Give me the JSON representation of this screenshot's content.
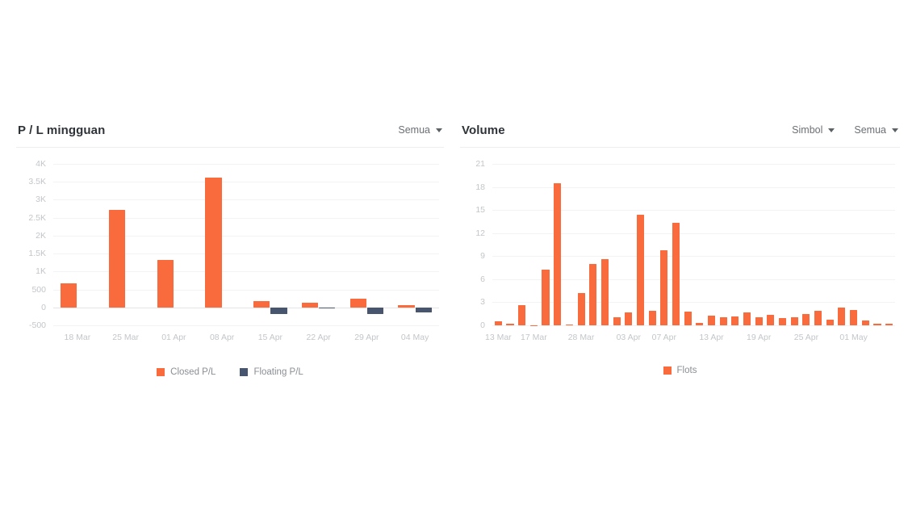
{
  "panels": {
    "left": {
      "title": "P / L mingguan",
      "controls": [
        {
          "label": "Semua",
          "icon": "chevron-down-icon"
        }
      ],
      "legend": [
        {
          "label": "Closed P/L",
          "color": "#f96b3c"
        },
        {
          "label": "Floating P/L",
          "color": "#47566e"
        }
      ]
    },
    "right": {
      "title": "Volume",
      "controls": [
        {
          "label": "Simbol",
          "icon": "chevron-down-icon"
        },
        {
          "label": "Semua",
          "icon": "chevron-down-icon"
        }
      ],
      "legend": [
        {
          "label": "Flots",
          "color": "#f96b3c"
        }
      ]
    }
  },
  "colors": {
    "orange": "#f96b3c",
    "slate": "#47566e",
    "grid": "#f2f3f4",
    "zero_line": "#e2e4e6",
    "axis_text": "#c3c6c9",
    "title_text": "#2e3338",
    "control_text": "#6b7075"
  },
  "chart_data": [
    {
      "id": "weekly-pl",
      "type": "bar",
      "title": "P / L mingguan",
      "xlabel": "",
      "ylabel": "",
      "ylim": [
        -500,
        4000
      ],
      "yticks": [
        4000,
        3500,
        3000,
        2500,
        2000,
        1500,
        1000,
        500,
        0,
        -500
      ],
      "ytick_labels": [
        "4K",
        "3.5K",
        "3K",
        "2.5K",
        "2K",
        "1.5K",
        "1K",
        "500",
        "0",
        "-500"
      ],
      "grid": true,
      "legend_position": "bottom",
      "categories": [
        "18 Mar",
        "25 Mar",
        "01 Apr",
        "08 Apr",
        "15 Apr",
        "22 Apr",
        "29 Apr",
        "04 May"
      ],
      "series": [
        {
          "name": "Closed P/L",
          "color": "#f96b3c",
          "values": [
            660,
            2720,
            1330,
            3620,
            170,
            140,
            240,
            60
          ]
        },
        {
          "name": "Floating P/L",
          "color": "#47566e",
          "values": [
            0,
            0,
            0,
            0,
            -180,
            -25,
            -185,
            -130
          ]
        }
      ]
    },
    {
      "id": "volume",
      "type": "bar",
      "title": "Volume",
      "xlabel": "",
      "ylabel": "",
      "ylim": [
        0,
        21
      ],
      "yticks": [
        21,
        18,
        15,
        12,
        9,
        6,
        3,
        0
      ],
      "ytick_labels": [
        "21",
        "18",
        "15",
        "12",
        "9",
        "6",
        "3",
        "0"
      ],
      "grid": true,
      "legend_position": "bottom",
      "xtick_labels": [
        "13 Mar",
        "17 Mar",
        "28 Mar",
        "03 Apr",
        "07 Apr",
        "13 Apr",
        "19 Apr",
        "25 Apr",
        "01 May"
      ],
      "xtick_indices": [
        0,
        3,
        7,
        11,
        14,
        18,
        22,
        26,
        30
      ],
      "series": [
        {
          "name": "Flots",
          "color": "#f96b3c",
          "values": [
            0.5,
            0.2,
            2.6,
            0.05,
            7.2,
            18.5,
            0.15,
            4.2,
            8.0,
            8.6,
            1.0,
            1.7,
            14.4,
            1.9,
            9.8,
            13.3,
            1.8,
            0.3,
            1.3,
            1.0,
            1.2,
            1.7,
            1.0,
            1.4,
            0.9,
            1.0,
            1.5,
            1.9,
            0.7,
            2.3,
            2.0,
            0.6,
            0.25,
            0.2
          ]
        }
      ]
    }
  ]
}
